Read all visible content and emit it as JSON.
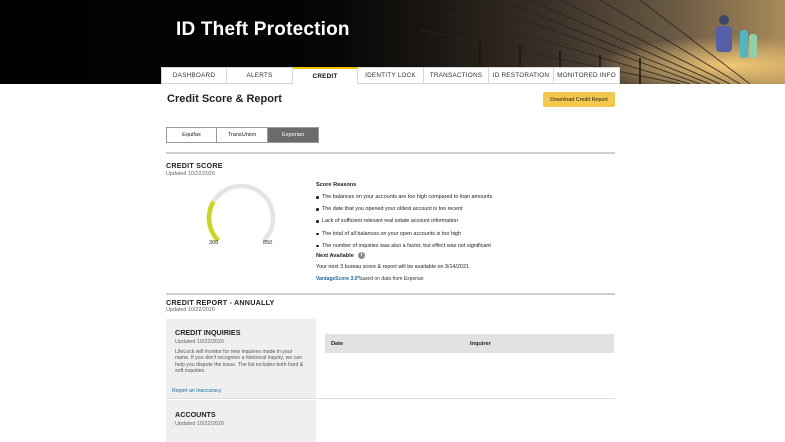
{
  "hero": {
    "title": "ID Theft Protection"
  },
  "nav": {
    "tabs": [
      {
        "label": "Dashboard",
        "active": false
      },
      {
        "label": "Alerts",
        "active": false
      },
      {
        "label": "Credit",
        "active": true
      },
      {
        "label": "Identity Lock",
        "active": false
      },
      {
        "label": "Transactions",
        "active": false
      },
      {
        "label": "ID Restoration",
        "active": false
      },
      {
        "label": "Monitored Info",
        "active": false
      }
    ]
  },
  "page": {
    "title": "Credit Score & Report",
    "download_label": "Download Credit Report"
  },
  "bureaus": {
    "options": [
      "Equifax",
      "TransUnion",
      "Experian"
    ],
    "selected": "Experian"
  },
  "credit_score": {
    "title": "CREDIT SCORE",
    "updated": "Updated 10/22/2020",
    "min_label": "300",
    "max_label": "850",
    "gauge_fill_fraction": 0.28,
    "gauge_color": "#c8d81f",
    "gauge_track_color": "#e4e4e4",
    "reasons_heading": "Score Reasons",
    "reasons": [
      "The balances on your accounts are too high compared to loan amounts",
      "The date that you opened your oldest account is too recent",
      "Lack of sufficient relevant real estate account information",
      "The total of all balances on your open accounts is too high",
      "The number of inquiries was also a factor, but effect was not significant"
    ],
    "next_available_label": "Next Available",
    "next_available_text": "Your next 3 bureau score & report will be available on 9/14/2021",
    "vantage_link": "VantageScore 3.0*",
    "vantage_suffix": "based on data from Experian"
  },
  "credit_report": {
    "title": "CREDIT REPORT - ANNUALLY",
    "updated": "Updated 10/22/2020",
    "inquiries": {
      "title": "CREDIT INQUIRIES",
      "updated": "Updated 10/22/2020",
      "description": "LifeLock will monitor for new inquiries made in your name. If you don't recognize a historical inquiry, we can help you dispute the issue. The list includes both hard & soft inquiries.",
      "link": "Report an Inaccuracy",
      "columns": [
        "Date",
        "Inquirer"
      ]
    },
    "accounts": {
      "title": "ACCOUNTS",
      "updated": "Updated 10/22/2020"
    }
  },
  "colors": {
    "accent": "#f3c300",
    "button": "#f3c84b",
    "link": "#1b6aa5"
  }
}
